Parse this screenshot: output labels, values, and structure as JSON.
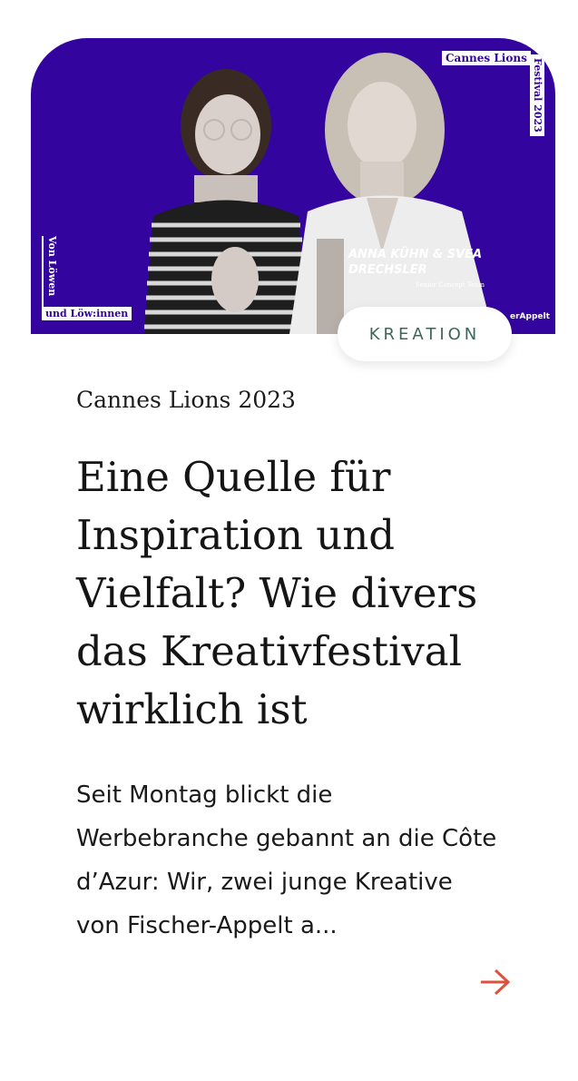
{
  "image": {
    "top_box": "Cannes Lions",
    "top_vertical": "Festival 2023",
    "left_vertical": "Von Löwen",
    "left_box": "und Löw:innen",
    "names": "ANNA KÜHN & SVEA DRECHSLER",
    "role": "Senior Concept Team",
    "brand": "erAppelt"
  },
  "category_tag": "KREATION",
  "kicker": "Cannes Lions 2023",
  "headline": "Eine Quelle für Inspiration und Vielfalt? Wie divers das Kreativfestival wirklich ist",
  "teaser": "Seit Montag blickt die Werbebranche gebannt an die Côte d’Azur: Wir, zwei junge Kreative von Fischer-Appelt a...",
  "colors": {
    "hero_bg": "#33059e",
    "tag_text": "#3c6758",
    "arrow": "#e0503c"
  },
  "icons": {
    "arrow": "arrow-right-icon"
  }
}
